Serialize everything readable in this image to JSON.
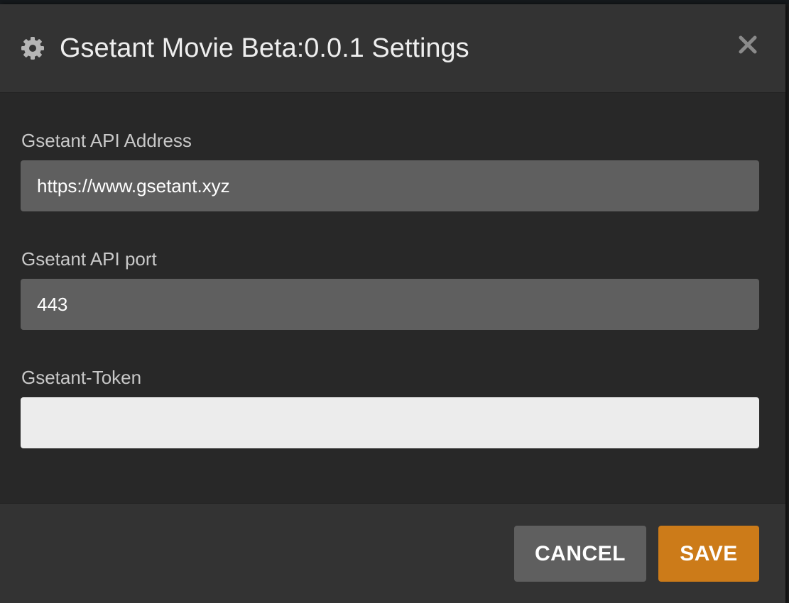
{
  "dialog": {
    "title": "Gsetant Movie Beta:0.0.1 Settings",
    "title_icon": "gear-icon",
    "close_icon": "close-icon"
  },
  "fields": [
    {
      "label": "Gsetant API Address",
      "value": "https://www.gsetant.xyz",
      "placeholder": ""
    },
    {
      "label": "Gsetant API port",
      "value": "443",
      "placeholder": ""
    },
    {
      "label": "Gsetant-Token",
      "value": "",
      "placeholder": ""
    }
  ],
  "footer": {
    "cancel_label": "CANCEL",
    "save_label": "SAVE"
  },
  "colors": {
    "accent": "#cc7b19",
    "header_bg": "#333333",
    "body_bg": "#282828",
    "input_bg": "#5f5f5f",
    "input_focus_bg": "#ececec"
  }
}
